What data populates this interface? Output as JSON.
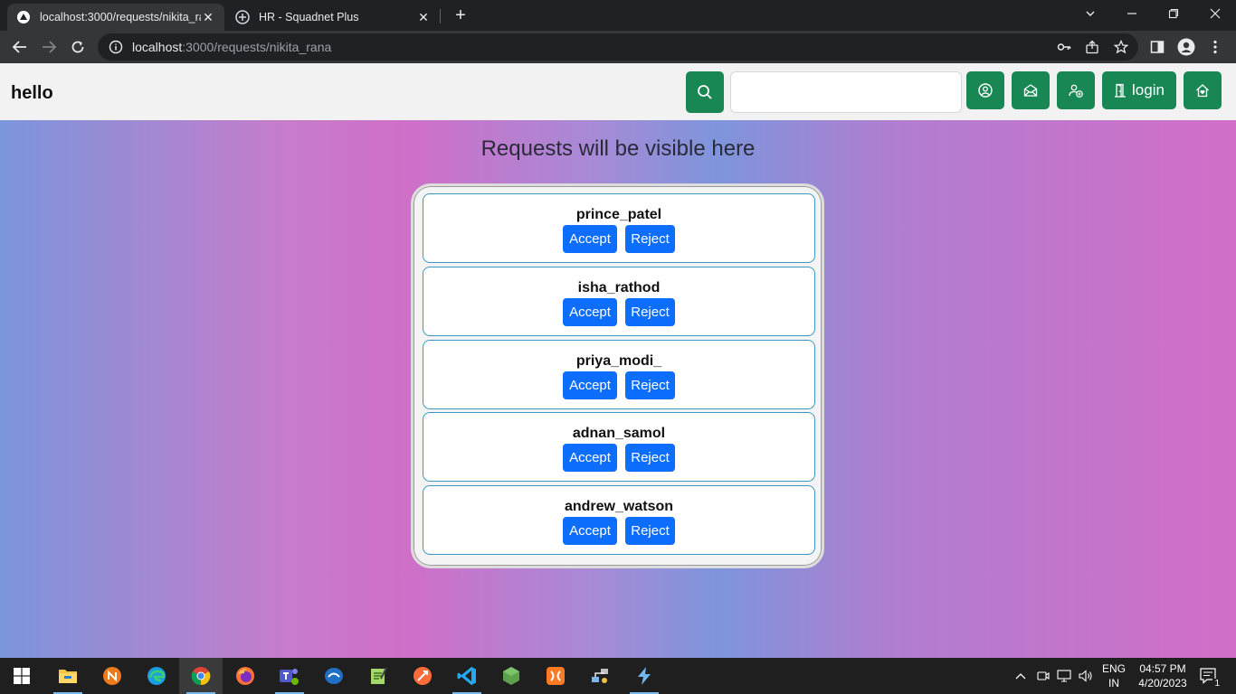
{
  "browser": {
    "tabs": [
      {
        "title": "localhost:3000/requests/nikita_ra",
        "active": true
      },
      {
        "title": "HR - Squadnet Plus",
        "active": false
      }
    ],
    "url_host": "localhost",
    "url_path": ":3000/requests/nikita_rana"
  },
  "header": {
    "brand": "hello",
    "search_value": "",
    "login_label": "login"
  },
  "main": {
    "heading": "Requests will be visible here",
    "accept_label": "Accept",
    "reject_label": "Reject",
    "requests": [
      {
        "username": "prince_patel"
      },
      {
        "username": "isha_rathod"
      },
      {
        "username": "priya_modi_"
      },
      {
        "username": "adnan_samol"
      },
      {
        "username": "andrew_watson"
      }
    ]
  },
  "taskbar": {
    "lang_line1": "ENG",
    "lang_line2": "IN",
    "time": "04:57 PM",
    "date": "4/20/2023",
    "notification_count": "1"
  },
  "colors": {
    "accent_green": "#198754",
    "button_blue": "#0d6efd",
    "card_border": "#3d97c2"
  }
}
